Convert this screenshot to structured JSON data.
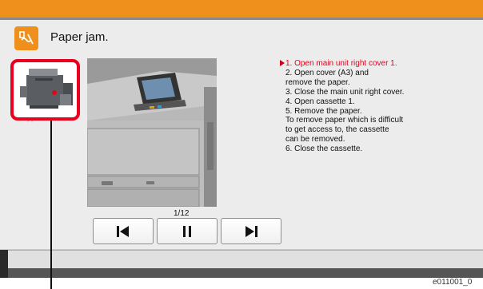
{
  "dialog": {
    "title": "Paper jam.",
    "icon": "paper-jam-icon",
    "accent_color": "#f0901c",
    "highlight_color": "#e8001c"
  },
  "thumbnail": {
    "icon": "printer-thumbnail-icon",
    "caption": "- -"
  },
  "photo": {
    "icon": "printer-photo"
  },
  "steps": [
    {
      "text": "1. Open main unit right cover 1.",
      "current": true
    },
    {
      "text": "2. Open cover (A3) and",
      "current": false
    },
    {
      "text": "remove the paper.",
      "current": false
    },
    {
      "text": "3. Close the main unit right cover.",
      "current": false
    },
    {
      "text": "4. Open cassette 1.",
      "current": false
    },
    {
      "text": "5. Remove the paper.",
      "current": false
    },
    {
      "text": "To remove paper which is difficult",
      "current": false
    },
    {
      "text": "to get access to, the cassette",
      "current": false
    },
    {
      "text": "can be removed.",
      "current": false
    },
    {
      "text": "6. Close the cassette.",
      "current": false
    }
  ],
  "pager": {
    "indicator": "1/12"
  },
  "controls": {
    "first_icon": "skip-to-start-icon",
    "pause_icon": "pause-icon",
    "last_icon": "skip-to-end-icon"
  },
  "figure_code": "e011001_0"
}
